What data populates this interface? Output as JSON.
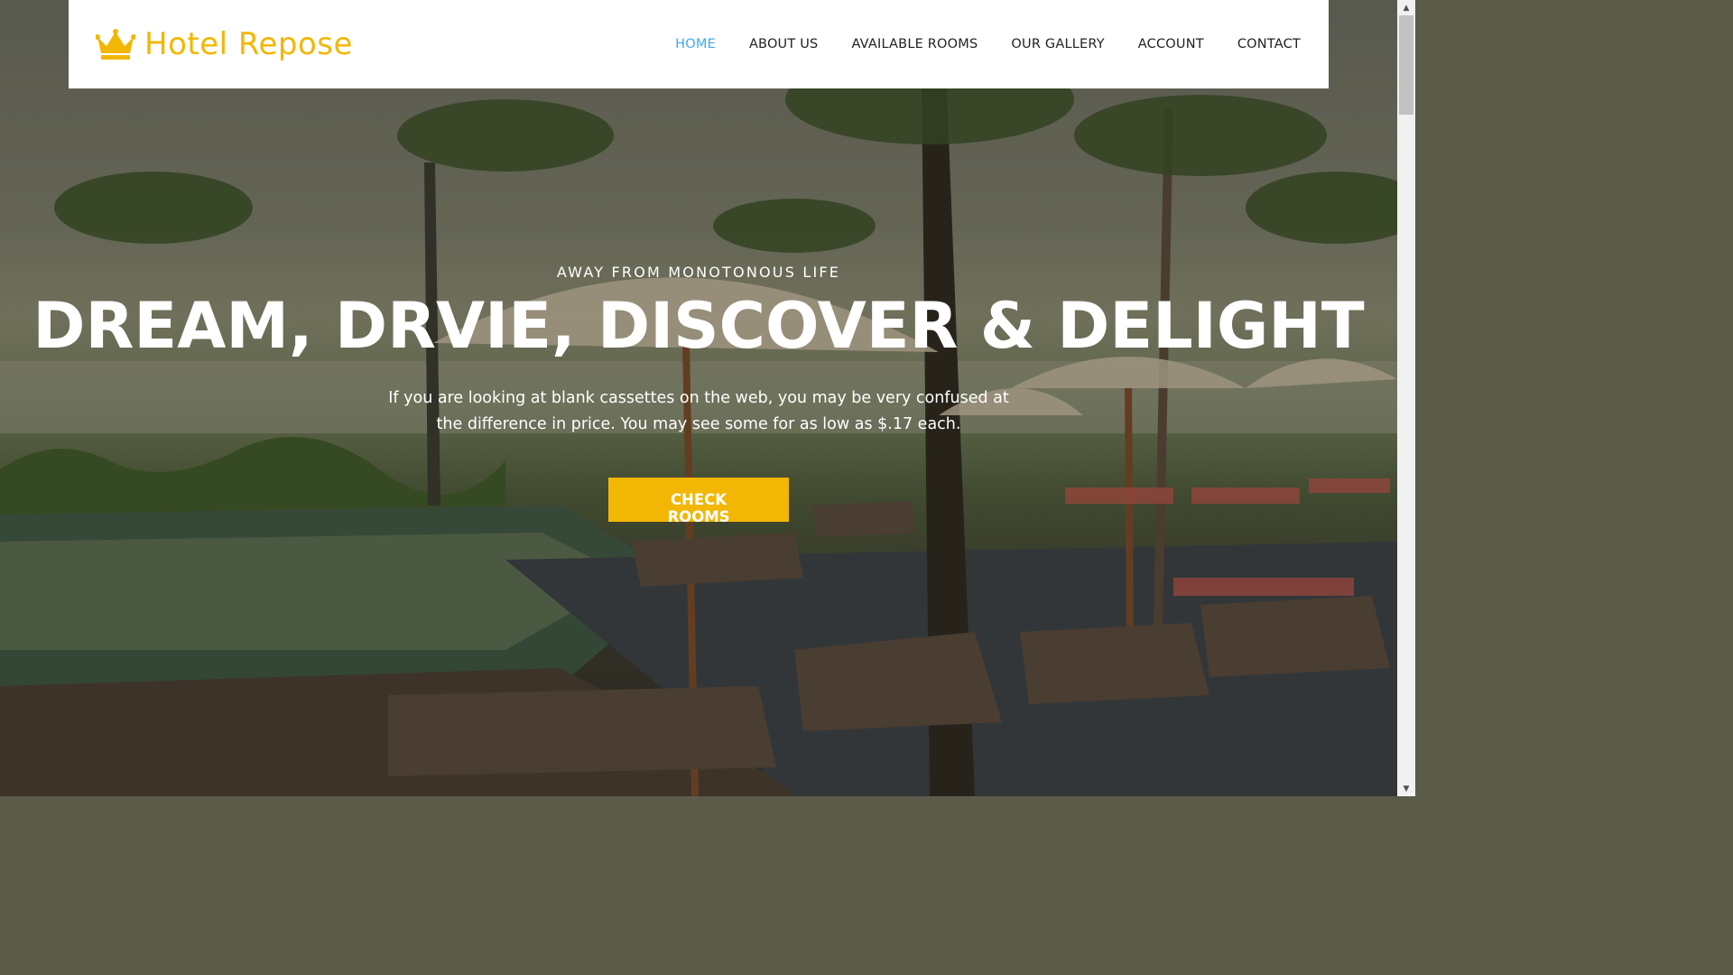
{
  "brand": {
    "name": "Hotel Repose",
    "icon": "crown-icon",
    "color": "#f2b705"
  },
  "nav": {
    "items": [
      {
        "label": "HOME",
        "active": true
      },
      {
        "label": "ABOUT US",
        "active": false
      },
      {
        "label": "AVAILABLE ROOMS",
        "active": false
      },
      {
        "label": "OUR GALLERY",
        "active": false
      },
      {
        "label": "ACCOUNT",
        "active": false
      },
      {
        "label": "CONTACT",
        "active": false
      }
    ],
    "active_color": "#3fa9f5"
  },
  "hero": {
    "eyebrow": "AWAY FROM MONOTONOUS LIFE",
    "headline": "DREAM, DRVIE, DISCOVER & DELIGHT",
    "description": "If you are looking at blank cassettes on the web, you may be very confused at the difference in price. You may see some for as low as $.17 each.",
    "cta_label": "CHECK ROOMS",
    "cta_color": "#f2b705"
  }
}
